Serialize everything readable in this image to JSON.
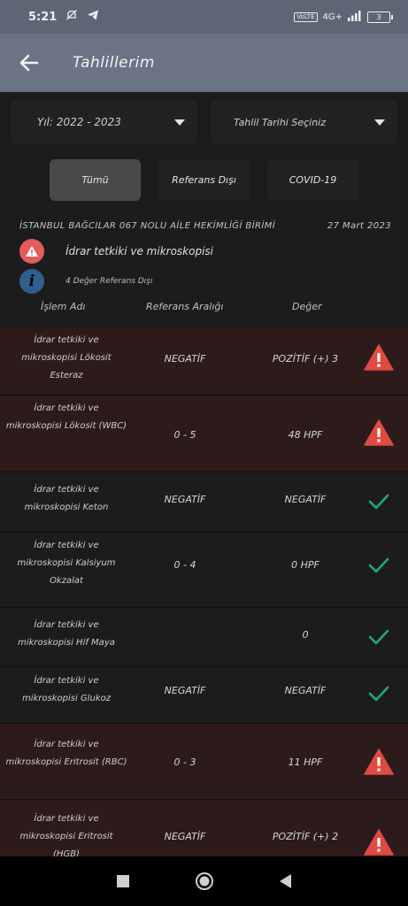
{
  "status_bar": {
    "time": "5:21",
    "signal_label": "4G+",
    "battery": "3",
    "net_badge": "VoLTE"
  },
  "app_bar": {
    "title": "Tahlillerim"
  },
  "filters": {
    "year_label": "Yıl: 2022 - 2023",
    "date_label": "Tahlil Tarihi Seçiniz"
  },
  "tabs": [
    {
      "label": "Tümü",
      "active": true
    },
    {
      "label": "Referans Dışı",
      "active": false
    },
    {
      "label": "COVID-19",
      "active": false
    }
  ],
  "hospital": {
    "name": "İSTANBUL BAĞCILAR 067 NOLU AİLE HEKİMLİĞİ BİRİMİ",
    "date": "27 Mart 2023"
  },
  "test": {
    "name": "İdrar tetkiki ve mikroskopisi",
    "info": "4 Değer Referans Dışı"
  },
  "table": {
    "headers": [
      "İşlem Adı",
      "Referans Aralığı",
      "Değer"
    ],
    "rows": [
      {
        "name": "İdrar tetkiki ve mikroskopisi Lökosit Esteraz",
        "ref": "NEGATİF",
        "value": "POZİTİF (+) 3",
        "status": "warning"
      },
      {
        "name": "İdrar tetkiki ve mikroskopisi Lökosit (WBC)",
        "ref": "0 - 5",
        "value": "48 HPF",
        "status": "warning"
      },
      {
        "name": "İdrar tetkiki ve mikroskopisi Keton",
        "ref": "NEGATİF",
        "value": "NEGATİF",
        "status": "ok"
      },
      {
        "name": "İdrar tetkiki ve mikroskopisi Kalsiyum Okzalat",
        "ref": "0 - 4",
        "value": "0 HPF",
        "status": "ok"
      },
      {
        "name": "İdrar tetkiki ve mikroskopisi Hif Maya",
        "ref": "",
        "value": "0",
        "status": "ok"
      },
      {
        "name": "İdrar tetkiki ve mikroskopisi Glukoz",
        "ref": "NEGATİF",
        "value": "NEGATİF",
        "status": "ok"
      },
      {
        "name": "İdrar tetkiki ve mikroskopisi Eritrosit (RBC)",
        "ref": "0 - 3",
        "value": "11 HPF",
        "status": "warning"
      },
      {
        "name": "İdrar tetkiki ve mikroskopisi Eritrosit (HGB)",
        "ref": "NEGATİF",
        "value": "POZİTİF (+) 2",
        "status": "warning"
      }
    ]
  },
  "colors": {
    "warning": "#e04a43",
    "ok": "#23a77e",
    "out_of_range_row": "#2c1b1a"
  },
  "nav": {
    "buttons": [
      "recent-apps-icon",
      "home-icon",
      "back-icon"
    ]
  }
}
